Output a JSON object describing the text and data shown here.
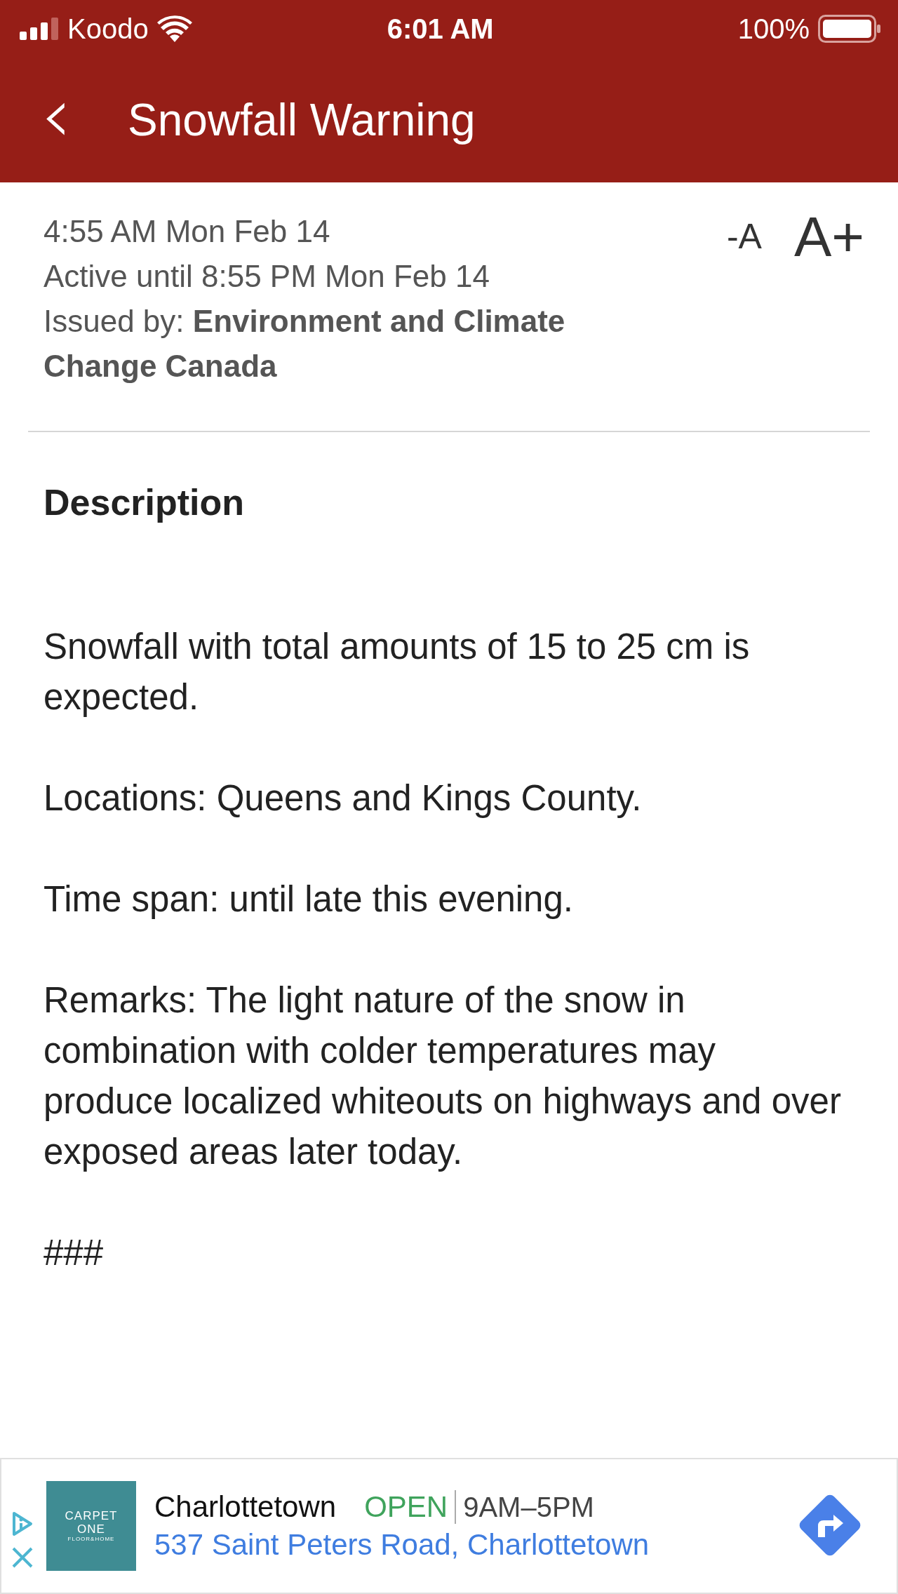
{
  "status_bar": {
    "carrier": "Koodo",
    "time": "6:01 AM",
    "battery": "100%"
  },
  "header": {
    "back": "‹",
    "title": "Snowfall Warning"
  },
  "meta": {
    "issued_time": "4:55 AM Mon Feb 14",
    "active_until": "Active until 8:55 PM Mon Feb 14",
    "issued_by": "Issued by: **Environment and Climate Change Canada**"
  },
  "font_controls": [
    "-A",
    "A+"
  ],
  "description": {
    "heading": "Description",
    "paragraphs": [
      "Snowfall with total amounts of 15 to 25 cm is expected.",
      "Locations: Queens and Kings County.",
      "Time span: until late this evening.",
      "Remarks: The light nature of the snow in combination with colder temperatures may produce localized whiteouts on highways and over exposed areas later today.",
      "###"
    ]
  },
  "ad": {
    "logo_lines": [
      "CARPET",
      "ONE",
      "FLOOR&HOME"
    ],
    "name": "Charlottetown",
    "status": "OPEN",
    "hours": "9AM–5PM",
    "address": "537 Saint Peters Road, Charlottetown"
  }
}
